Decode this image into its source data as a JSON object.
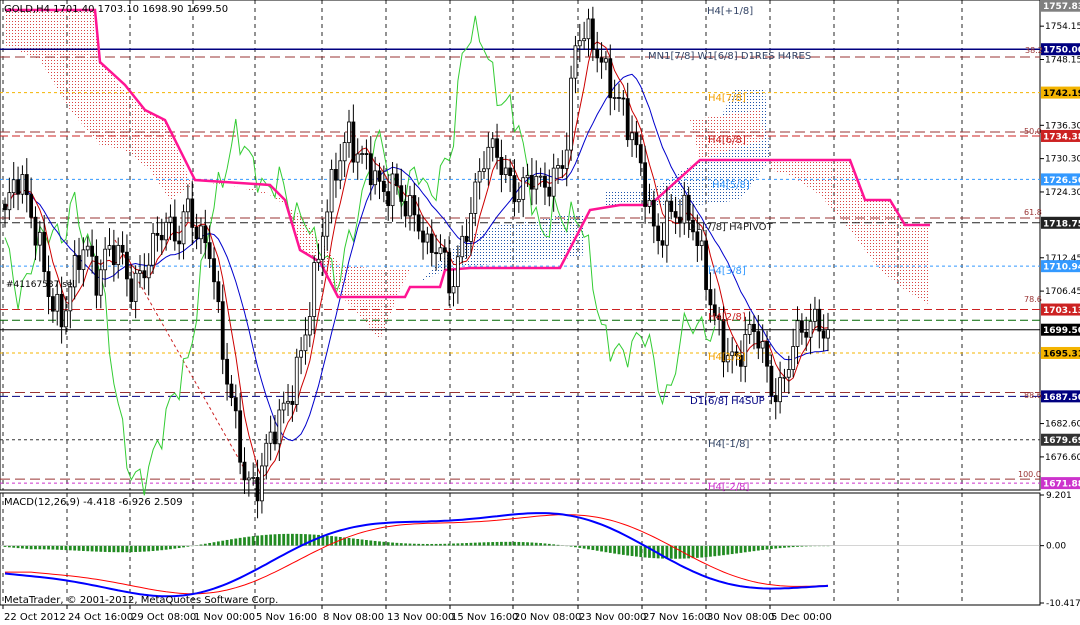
{
  "main_panel": {
    "header": "GOLD,H4  1701.40 1703.10 1698.90 1699.50",
    "position_label": "#41167537 sell",
    "copyright": "MetaTrader, © 2001-2012, MetaQuotes Software Corp.",
    "y_ticks": [
      "1754.15",
      "1748.15",
      "1736.30",
      "1730.30",
      "1724.30",
      "1712.45",
      "1706.45",
      "1682.60",
      "1676.60"
    ],
    "price_tags": [
      {
        "text": "1757.83",
        "bg": "#808080",
        "fg": "#ffffff"
      },
      {
        "text": "1750.00",
        "bg": "#000080",
        "fg": "#ffffff"
      },
      {
        "text": "1742.19",
        "bg": "#f4b400",
        "fg": "#000000"
      },
      {
        "text": "1734.38",
        "bg": "#cc2222",
        "fg": "#ffffff"
      },
      {
        "text": "1726.56",
        "bg": "#3399ff",
        "fg": "#ffffff"
      },
      {
        "text": "1718.75",
        "bg": "#222222",
        "fg": "#ffffff"
      },
      {
        "text": "1710.94",
        "bg": "#3399ff",
        "fg": "#ffffff"
      },
      {
        "text": "1703.13",
        "bg": "#cc2222",
        "fg": "#ffffff"
      },
      {
        "text": "1699.50",
        "bg": "#000000",
        "fg": "#ffffff"
      },
      {
        "text": "1695.31",
        "bg": "#f4b400",
        "fg": "#000000"
      },
      {
        "text": "1687.50",
        "bg": "#000080",
        "fg": "#ffffff"
      },
      {
        "text": "1679.69",
        "bg": "#333333",
        "fg": "#ffffff"
      },
      {
        "text": "1671.88",
        "bg": "#cc33cc",
        "fg": "#ffffff"
      }
    ],
    "fib_labels": [
      "38.2",
      "50.0",
      "61.8",
      "78.6",
      "88.6",
      "100.0"
    ],
    "level_labels": [
      {
        "text": "H4[+1/8]",
        "color": "#334466"
      },
      {
        "text": "MN1[7/8] W1[6/8] D1RES H4RES",
        "color": "#334466"
      },
      {
        "text": "H4[7/8]",
        "color": "#f4a000"
      },
      {
        "text": "H4[6/8]",
        "color": "#cc2222"
      },
      {
        "text": "H4[5/8]",
        "color": "#3399ff"
      },
      {
        "text": "D1[7/8] H4PIVOT",
        "color": "#222222"
      },
      {
        "text": "H4[3/8]",
        "color": "#3399ff"
      },
      {
        "text": "H4[2/8]",
        "color": "#cc2222"
      },
      {
        "text": "H4[1/8]",
        "color": "#f4a000"
      },
      {
        "text": "D1[6/8] H4SUP",
        "color": "#000080"
      },
      {
        "text": "H4[-1/8]",
        "color": "#334466"
      },
      {
        "text": "H4[-2/8]",
        "color": "#cc33cc"
      }
    ]
  },
  "macd_panel": {
    "header": "MACD(12,26,9) -4.418 -6.926 2.509",
    "y_ticks": [
      "9.201",
      "0.00",
      "-10.417"
    ]
  },
  "x_labels": [
    "22 Oct 2012",
    "24 Oct 16:00",
    "29 Oct 08:00",
    "1 Nov 00:00",
    "5 Nov 16:00",
    "8 Nov 08:00",
    "13 Nov 00:00",
    "15 Nov 16:00",
    "20 Nov 08:00",
    "23 Nov 00:00",
    "27 Nov 16:00",
    "30 Nov 08:00",
    "5 Dec 00:00"
  ],
  "colors": {
    "candles": "#000000",
    "ichimoku_tenkan": "#cc0000",
    "ichimoku_kijun": "#0000cc",
    "ichimoku_senkou_b": "#ff1493",
    "ichimoku_chikou": "#33cc33",
    "kumo_bull": "#cc3333",
    "kumo_bear": "#2255aa",
    "macd_hist": "#228b22",
    "macd_line": "#0000ff",
    "macd_signal": "#ff0000"
  },
  "chart_data": {
    "type": "candlestick",
    "symbol": "GOLD",
    "timeframe": "H4",
    "ylim": [
      1671.0,
      1758.5
    ],
    "approx_close_path": [
      1720,
      1726,
      1722,
      1716,
      1706,
      1700,
      1708,
      1716,
      1710,
      1714,
      1712,
      1706,
      1711,
      1716,
      1718,
      1714,
      1722,
      1718,
      1714,
      1694,
      1684,
      1674,
      1672,
      1678,
      1682,
      1688,
      1698,
      1708,
      1718,
      1728,
      1736,
      1732,
      1728,
      1722,
      1726,
      1724,
      1720,
      1712,
      1714,
      1708,
      1716,
      1722,
      1730,
      1732,
      1728,
      1724,
      1726,
      1724,
      1728,
      1732,
      1752,
      1751,
      1749,
      1745,
      1740,
      1732,
      1724,
      1716,
      1722,
      1720,
      1718,
      1712,
      1704,
      1696,
      1692,
      1698,
      1700,
      1690,
      1688,
      1696,
      1700,
      1703,
      1699.5
    ],
    "last_bar": {
      "open": 1701.4,
      "high": 1703.1,
      "low": 1698.9,
      "close": 1699.5
    },
    "levels": [
      1750.0,
      1742.19,
      1734.38,
      1726.56,
      1718.75,
      1710.94,
      1703.13,
      1695.31,
      1687.5,
      1679.69,
      1671.88
    ],
    "macd": {
      "params": "12,26,9",
      "main": -4.418,
      "signal": -6.926,
      "histogram": 2.509,
      "ylim": [
        -10.417,
        9.201
      ]
    }
  }
}
